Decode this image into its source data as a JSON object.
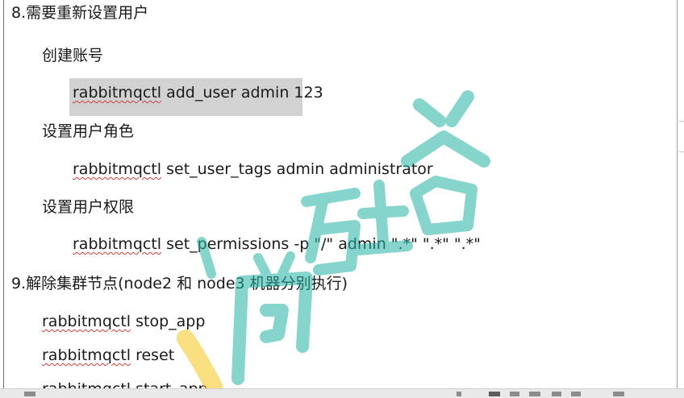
{
  "document": {
    "section8_title": "8.需要重新设置用户",
    "create_account_label": "创建账号",
    "add_user_cmd_word": "rabbitmqctl",
    "add_user_cmd_rest": " add_user admin 123",
    "set_role_label": "设置用户角色",
    "set_tags_cmd_word": "rabbitmqctl",
    "set_tags_cmd_rest": " set_user_tags admin administrator",
    "set_perm_label": "设置用户权限",
    "set_perm_cmd_word": "rabbitmqctl",
    "set_perm_cmd_rest": " set_permissions -p \"/\" admin \".*\" \".*\" \".*\"",
    "section9_title": "9.解除集群节点(node2 和 node3 机器分别执行)",
    "stop_app_word": "rabbitmqctl",
    "stop_app_rest": " stop_app",
    "reset_word": "rabbitmqctl",
    "reset_rest": " reset",
    "start_app_word": "rabbitmqctl",
    "start_app_rest": " start_app"
  },
  "watermark": {
    "text": "尚硅谷",
    "colors": [
      "#22b3a6",
      "#f5c518"
    ]
  }
}
